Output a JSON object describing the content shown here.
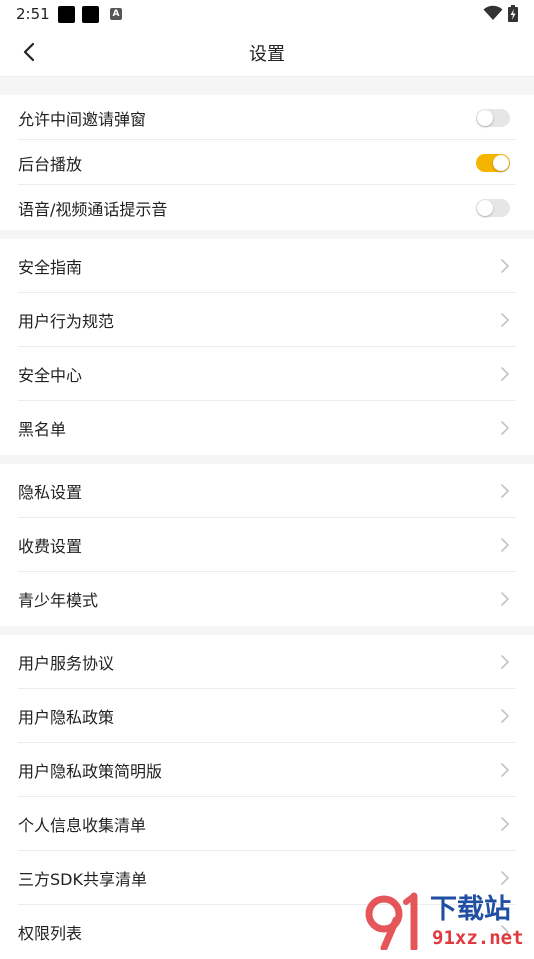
{
  "status_bar": {
    "time": "2:51",
    "notification_badge": "A"
  },
  "header": {
    "title": "设置"
  },
  "accent_color": "#f5b400",
  "toggles": [
    {
      "label": "允许中间邀请弹窗",
      "on": false
    },
    {
      "label": "后台播放",
      "on": true
    },
    {
      "label": "语音/视频通话提示音",
      "on": false
    }
  ],
  "group2": [
    "安全指南",
    "用户行为规范",
    "安全中心",
    "黑名单"
  ],
  "group3": [
    "隐私设置",
    "收费设置",
    "青少年模式"
  ],
  "group4": [
    "用户服务协议",
    "用户隐私政策",
    "用户隐私政策简明版",
    "个人信息收集清单",
    "三方SDK共享清单",
    "权限列表"
  ],
  "watermark": {
    "brand": "下载站",
    "site": "91xz.net",
    "logo_icon": "91-logo-icon"
  }
}
